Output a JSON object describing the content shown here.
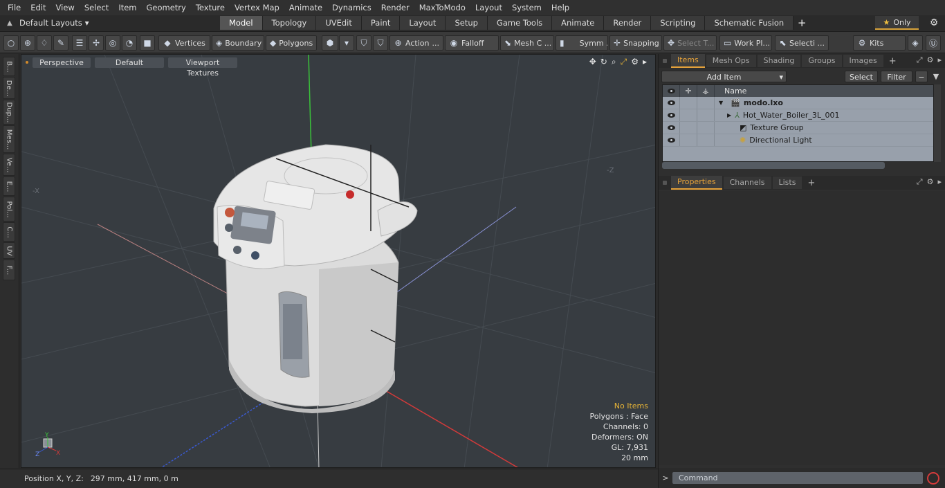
{
  "menu": [
    "File",
    "Edit",
    "View",
    "Select",
    "Item",
    "Geometry",
    "Texture",
    "Vertex Map",
    "Animate",
    "Dynamics",
    "Render",
    "MaxToModo",
    "Layout",
    "System",
    "Help"
  ],
  "layout_selector": {
    "label": "Default Layouts",
    "arrow": "▾"
  },
  "workspace_tabs": [
    {
      "label": "Model",
      "active": true
    },
    {
      "label": "Topology"
    },
    {
      "label": "UVEdit"
    },
    {
      "label": "Paint"
    },
    {
      "label": "Layout"
    },
    {
      "label": "Setup"
    },
    {
      "label": "Game Tools"
    },
    {
      "label": "Animate"
    },
    {
      "label": "Render"
    },
    {
      "label": "Scripting"
    },
    {
      "label": "Schematic Fusion"
    }
  ],
  "tab_add": "+",
  "only_button": {
    "label": "Only",
    "star": "★"
  },
  "toolbar": {
    "vertices": "Vertices",
    "boundary": "Boundary",
    "polygons": "Polygons",
    "action": "Action",
    "action_more": "...",
    "falloff": "Falloff",
    "mesh": "Mesh C ...",
    "symmetry": "Symm ...",
    "snapping": "Snapping",
    "select_t": "Select T...",
    "work_plane": "Work Pl...",
    "selection": "Selecti ...",
    "kits": "Kits"
  },
  "left_tabs": [
    "B...",
    "De...",
    "Dup...",
    "Mes...",
    "Ve...",
    "E...",
    "Pol...",
    "C...",
    "UV",
    "F..."
  ],
  "viewport": {
    "view": "Perspective",
    "shading": "Default",
    "textures": "Viewport Textures",
    "info": {
      "no_items": "No Items",
      "polygons": "Polygons : Face",
      "channels": "Channels: 0",
      "deformers": "Deformers: ON",
      "gl": "GL: 7,931",
      "scale": "20 mm"
    },
    "axis_labels": {
      "x": "X",
      "y": "Y",
      "z": "Z",
      "neg_x": "-X",
      "neg_z": "-Z"
    },
    "colors": {
      "bg": "#373c41",
      "x_axis": "#d23a3a",
      "y_axis": "#3ac23a",
      "z_axis": "#3a5ad2"
    }
  },
  "status": {
    "label": "Position X, Y, Z:",
    "value": "297 mm, 417 mm, 0 m"
  },
  "items_panel": {
    "tabs": [
      {
        "label": "Items",
        "active": true
      },
      {
        "label": "Mesh Ops"
      },
      {
        "label": "Shading"
      },
      {
        "label": "Groups"
      },
      {
        "label": "Images"
      }
    ],
    "add_item": "Add Item",
    "select": "Select",
    "filter": "Filter",
    "column_name": "Name",
    "rows": [
      {
        "name": "modo.lxo",
        "icon": "scene-icon",
        "expander": "▼",
        "bold": true
      },
      {
        "name": "Hot_Water_Boiler_3L_001",
        "icon": "locator-icon",
        "expander": "▶"
      },
      {
        "name": "Texture Group",
        "icon": "texture-group-icon"
      },
      {
        "name": "Directional Light",
        "icon": "light-icon"
      }
    ]
  },
  "properties_panel": {
    "tabs": [
      {
        "label": "Properties",
        "active": true
      },
      {
        "label": "Channels"
      },
      {
        "label": "Lists"
      }
    ]
  },
  "command": {
    "prompt": ">",
    "placeholder": "Command"
  }
}
